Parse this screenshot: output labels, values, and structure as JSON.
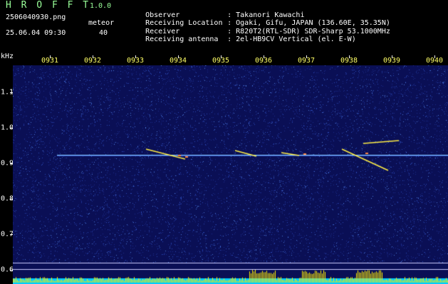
{
  "app": {
    "name": "H R O F F T",
    "version": "1.0.0"
  },
  "file": "2506040930.png",
  "meteor_label": "meteor",
  "datetime": "25.06.04 09:30",
  "meteor_count": "40",
  "meta": [
    {
      "key": "Observer",
      "value": ": Takanori Kawachi"
    },
    {
      "key": "Receiving Location",
      "value": ": Ogaki, Gifu, JAPAN (136.60E, 35.35N)"
    },
    {
      "key": "Receiver",
      "value": ": R820T2(RTL-SDR) SDR-Sharp 53.1000MHz"
    },
    {
      "key": "Receiving antenna",
      "value": ": 2el-HB9CV Vertical (el. E-W)"
    }
  ],
  "axis_unit": "kHz",
  "x_ticks": [
    "0931",
    "0932",
    "0933",
    "0934",
    "0935",
    "0936",
    "0937",
    "0938",
    "0939",
    "0940"
  ],
  "y_ticks": [
    "1.1",
    "1.0",
    "0.9",
    "0.8",
    "0.7",
    "0.6"
  ],
  "colors": {
    "accent": "#99ff99",
    "tick": "#ffff66",
    "carrier": "#88ccff",
    "meteor": "#ffee44",
    "floor": "#00ccff"
  }
}
